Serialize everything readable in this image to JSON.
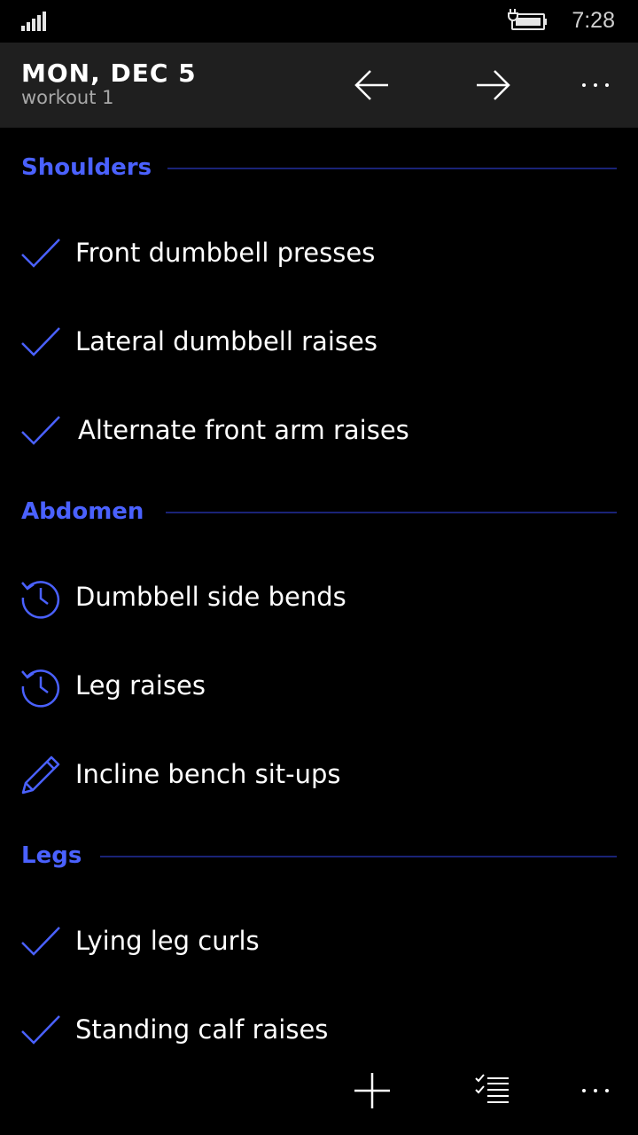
{
  "status_bar": {
    "time": "7:28",
    "signal_icon": "signal-bars-icon",
    "battery_icon": "battery-charging-icon"
  },
  "header": {
    "title": "MON, DEC 5",
    "subtitle": "workout 1",
    "prev_icon": "arrow-left-icon",
    "next_icon": "arrow-right-icon",
    "more_icon": "more-dots-icon"
  },
  "colors": {
    "accent": "#4a61ff",
    "section_line": "#1a2377",
    "header_bg": "#1f1f1f",
    "background": "#000000",
    "text": "#ffffff",
    "subtitle": "#a8a8a8"
  },
  "sections": [
    {
      "title": "Shoulders",
      "items": [
        {
          "label": "Front dumbbell presses",
          "status_icon": "checkmark-icon"
        },
        {
          "label": "Lateral dumbbell raises",
          "status_icon": "checkmark-icon"
        },
        {
          "label": "Alternate front arm raises",
          "status_icon": "checkmark-icon"
        }
      ]
    },
    {
      "title": "Abdomen",
      "items": [
        {
          "label": "Dumbbell side bends",
          "status_icon": "history-icon"
        },
        {
          "label": "Leg raises",
          "status_icon": "history-icon"
        },
        {
          "label": "Incline bench sit-ups",
          "status_icon": "pencil-icon"
        }
      ]
    },
    {
      "title": "Legs",
      "items": [
        {
          "label": "Lying leg curls",
          "status_icon": "checkmark-icon"
        },
        {
          "label": "Standing calf raises",
          "status_icon": "checkmark-icon"
        }
      ]
    }
  ],
  "app_bar": {
    "add_icon": "plus-icon",
    "select_icon": "checklist-icon",
    "more_icon": "more-dots-icon"
  }
}
